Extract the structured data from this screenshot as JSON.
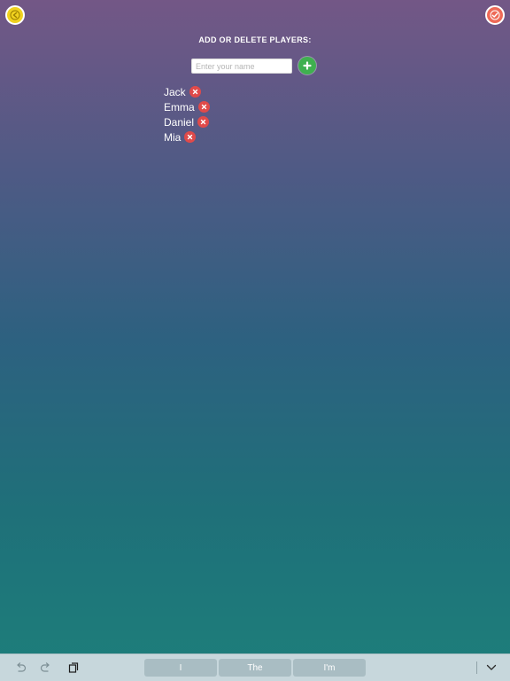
{
  "header": {
    "back_icon": "arrow-left-circle-icon",
    "done_icon": "checkmark-circle-icon",
    "title": "ADD OR DELETE PLAYERS:"
  },
  "form": {
    "placeholder": "Enter your name",
    "value": "",
    "add_icon": "plus-icon"
  },
  "players": [
    {
      "name": "Jack"
    },
    {
      "name": "Emma"
    },
    {
      "name": "Daniel"
    },
    {
      "name": "Mia"
    }
  ],
  "keyboard": {
    "undo_icon": "undo-icon",
    "redo_icon": "redo-icon",
    "paste_icon": "paste-icon",
    "suggestions": [
      "I",
      "The",
      "I'm"
    ],
    "dismiss_icon": "chevron-down-icon"
  },
  "colors": {
    "back_button": "#f1d21f",
    "done_button": "#ee6a57",
    "add_button": "#3fb04f",
    "delete_button": "#e04a4a"
  }
}
